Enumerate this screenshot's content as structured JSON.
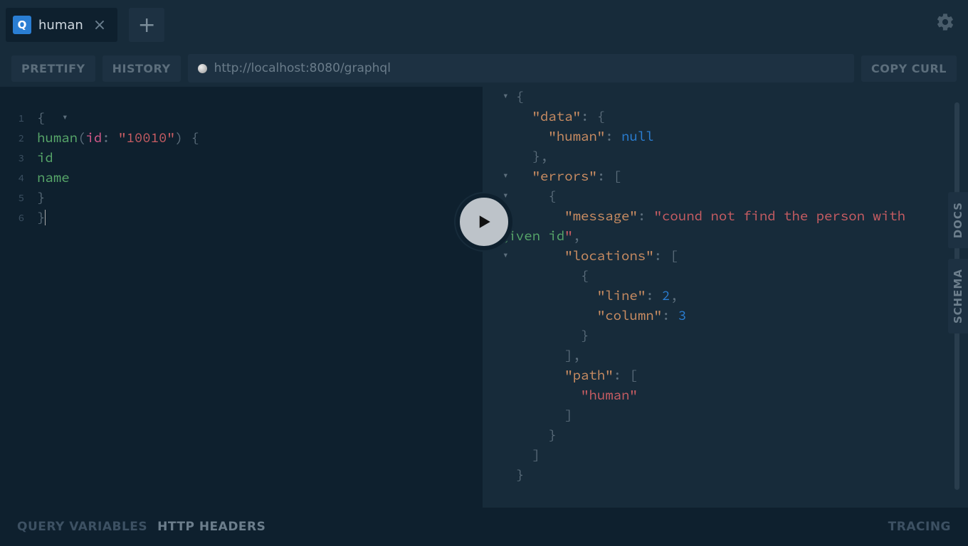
{
  "tabs": {
    "active": {
      "badge": "Q",
      "title": "human"
    }
  },
  "toolbar": {
    "prettify": "PRETTIFY",
    "history": "HISTORY",
    "copy_curl": "COPY CURL",
    "url": "http://localhost:8080/graphql"
  },
  "editor": {
    "lines": [
      "1",
      "2",
      "3",
      "4",
      "5",
      "6"
    ],
    "query": {
      "field": "human",
      "arg_name": "id",
      "arg_value": "\"10010\"",
      "sel1": "id",
      "sel2": "name"
    }
  },
  "response": {
    "data_key": "\"data\"",
    "human_key": "\"human\"",
    "human_val": "null",
    "errors_key": "\"errors\"",
    "message_key": "\"message\"",
    "message_val_prefix": "\"cound not find the person with ",
    "message_val_green1": "given",
    "message_val_green2": "id",
    "message_val_end": "\"",
    "locations_key": "\"locations\"",
    "line_key": "\"line\"",
    "line_val": "2",
    "column_key": "\"column\"",
    "column_val": "3",
    "path_key": "\"path\"",
    "path_val": "\"human\""
  },
  "side": {
    "docs": "DOCS",
    "schema": "SCHEMA"
  },
  "footer": {
    "query_vars": "QUERY VARIABLES",
    "http_headers": "HTTP HEADERS",
    "tracing": "TRACING"
  }
}
